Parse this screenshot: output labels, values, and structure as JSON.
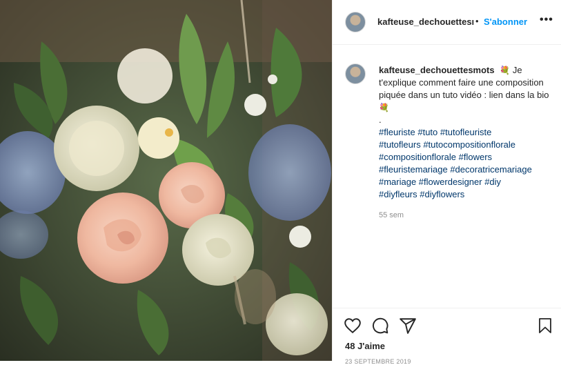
{
  "post": {
    "username": "kafteuse_dechouettesmots",
    "header_username": "kafteuse_dechouettesı",
    "separator": "•",
    "follow_label": "S'abonner",
    "more_label": "•••",
    "caption": {
      "text_line1": "Je t'explique comment faire une composition piquée dans un tuto vidéo : lien dans la bio",
      "dot": ".",
      "hashtag_lines": [
        "#fleuriste #tuto #tutofleuriste",
        "#tutofleurs #tutocompositionflorale",
        "#compositionflorale #flowers",
        "#fleuristemariage #decoratricemariage",
        "#mariage #flowerdesigner #diy",
        "#diyfleurs #diyflowers"
      ],
      "emoji_glyph": "💐"
    },
    "time_ago": "55 sem",
    "likes_text": "48 J'aime",
    "date_text": "23 SEPTEMBRE 2019"
  },
  "icons": [
    "heart-icon",
    "comment-icon",
    "share-icon",
    "bookmark-icon",
    "more-options-icon",
    "bouquet-emoji-icon"
  ],
  "colors": {
    "link_blue": "#0095f6",
    "hashtag": "#00376b",
    "text": "#262626",
    "muted": "#8e8e8e",
    "border": "#efefef"
  }
}
